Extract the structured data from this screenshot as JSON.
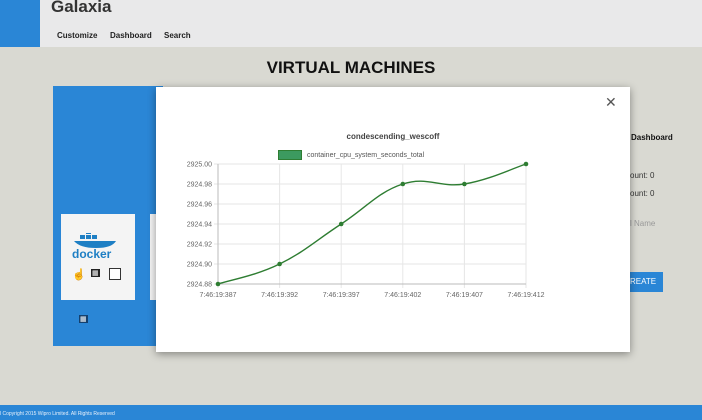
{
  "app": {
    "brand": "Galaxia"
  },
  "nav": {
    "customize": "Customize",
    "dashboard": "Dashboard",
    "search": "Search"
  },
  "page": {
    "title": "VIRTUAL MACHINES"
  },
  "cards": [
    {
      "logo_text": "docker"
    }
  ],
  "right_panel": {
    "heading": "Dashboard",
    "count1": "ount: 0",
    "count2": "ount: 0",
    "name_placeholder": "l Name",
    "create_label": "REATE"
  },
  "footer": {
    "text": "l Copyright 2015 Wipro Limited. All Rights Reserved"
  },
  "modal": {
    "close_icon": "close-icon",
    "chart_data": {
      "type": "line",
      "title": "condescending_wescoff",
      "series": [
        {
          "name": "container_cpu_system_seconds_total",
          "color": "#2e7d32",
          "fill": "#3c9a5f",
          "values": [
            2924.88,
            2924.9,
            2924.94,
            2924.98,
            2924.98,
            2925.0
          ]
        }
      ],
      "x": [
        "7:46:19:387",
        "7:46:19:392",
        "7:46:19:397",
        "7:46:19:402",
        "7:46:19:407",
        "7:46:19:412"
      ],
      "yticks": [
        "2924.88",
        "2924.90",
        "2924.92",
        "2924.94",
        "2924.96",
        "2924.98",
        "2925.00"
      ],
      "ylim": [
        2924.88,
        2925.0
      ],
      "grid": true,
      "legend": "top-center"
    }
  }
}
